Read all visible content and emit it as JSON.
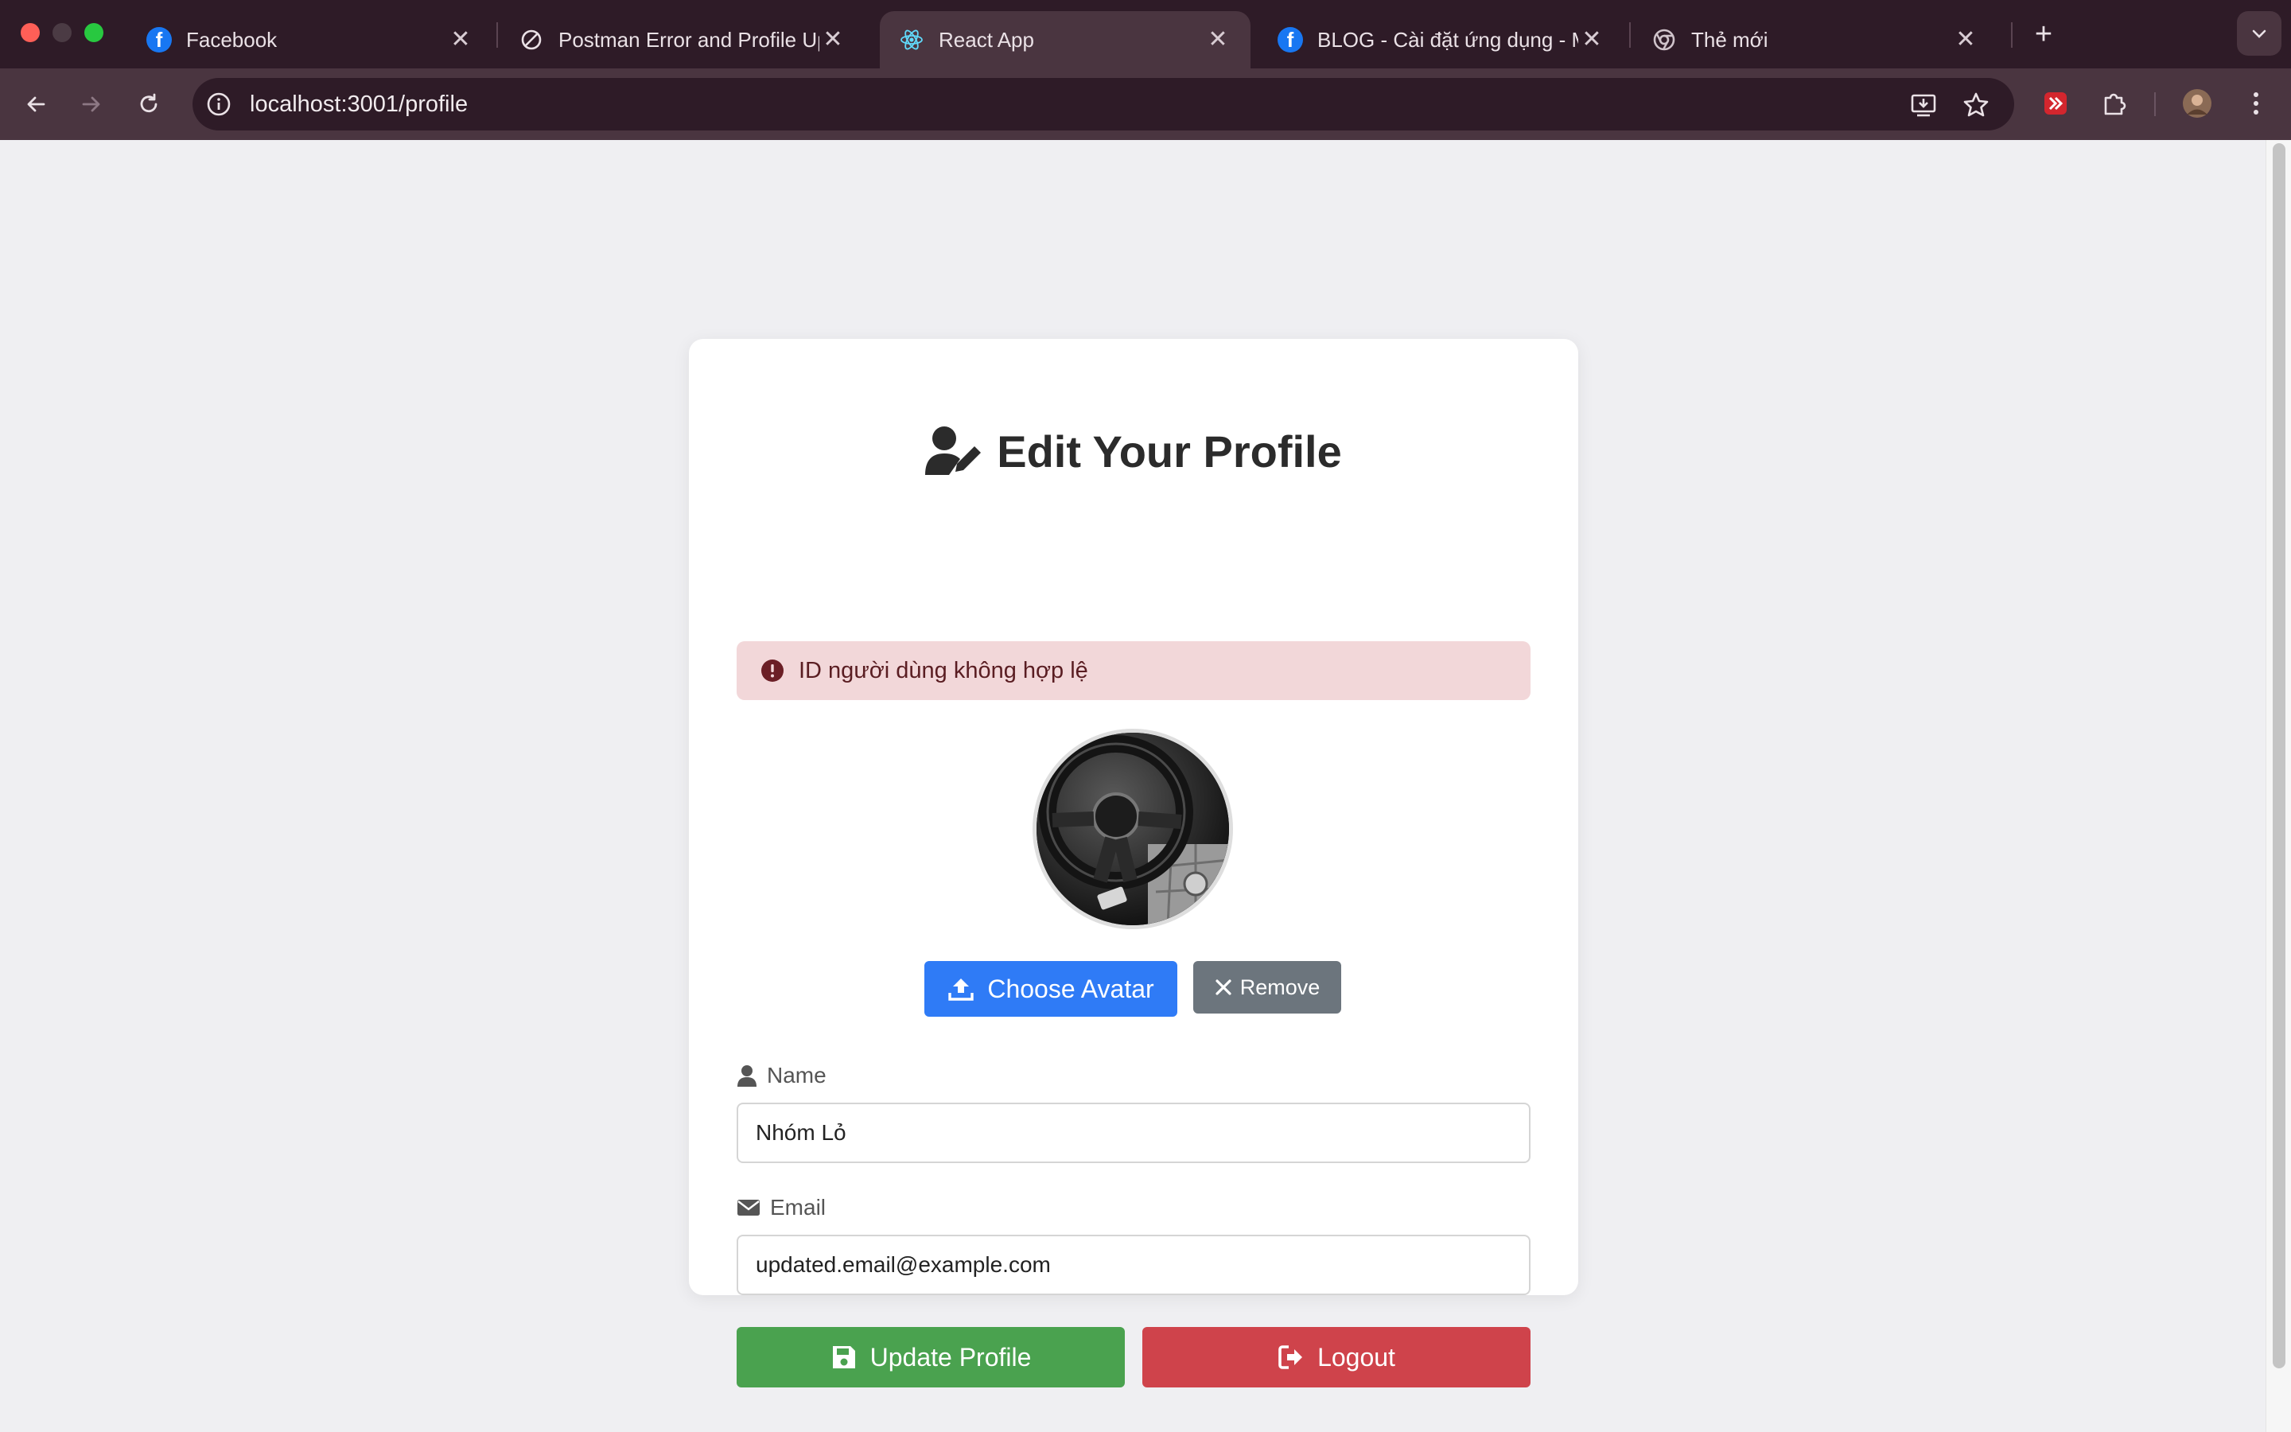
{
  "browser": {
    "tabs": [
      {
        "label": "Facebook",
        "favicon": "facebook-icon",
        "active": false
      },
      {
        "label": "Postman Error and Profile Up",
        "favicon": "chatgpt-icon",
        "active": false
      },
      {
        "label": "React App",
        "favicon": "react-icon",
        "active": true
      },
      {
        "label": "BLOG - Cài đặt ứng dụng - M",
        "favicon": "facebook-icon",
        "active": false
      },
      {
        "label": "Thẻ mới",
        "favicon": "chrome-icon",
        "active": false
      }
    ],
    "url": "localhost:3001/profile"
  },
  "profile": {
    "title": "Edit Your Profile",
    "alert": "ID người dùng không hợp lệ",
    "choose_avatar_label": "Choose Avatar",
    "remove_label": "Remove",
    "name_label": "Name",
    "name_value": "Nhóm Lỏ",
    "email_label": "Email",
    "email_value": "updated.email@example.com",
    "update_label": "Update Profile",
    "logout_label": "Logout"
  },
  "colors": {
    "tabbar": "#2e1b27",
    "toolbar": "#4a3540",
    "primary": "#2f7bf6",
    "secondary": "#6c757d",
    "success": "#4aa24f",
    "danger": "#cf434b",
    "alert_bg": "#f2d7d9"
  }
}
